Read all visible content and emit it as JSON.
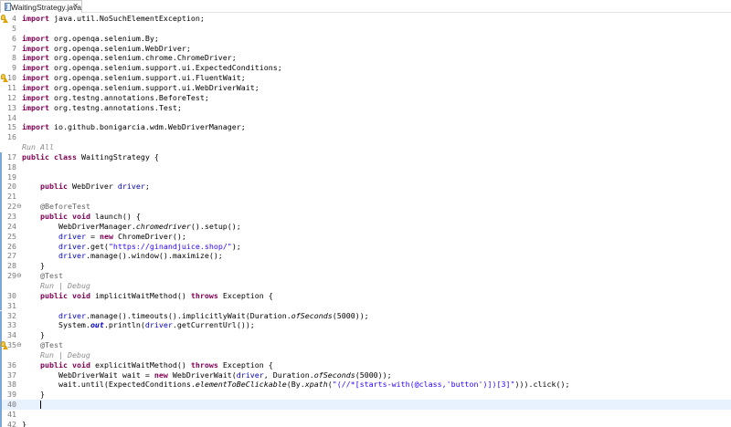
{
  "tab": {
    "title": "WaitingStrategy.java",
    "close": "✕",
    "icon": "java-file-icon"
  },
  "lines": [
    {
      "num": "4",
      "marker": "warning-bulb",
      "ruler": "none",
      "fold": "",
      "current": false,
      "segments": [
        {
          "t": "import",
          "c": "kw"
        },
        {
          "t": " java.util.NoSuchElementException;",
          "c": ""
        }
      ]
    },
    {
      "num": "5",
      "ruler": "none",
      "segments": []
    },
    {
      "num": "6",
      "ruler": "none",
      "segments": [
        {
          "t": "import",
          "c": "kw"
        },
        {
          "t": " org.openqa.selenium.By;",
          "c": ""
        }
      ]
    },
    {
      "num": "7",
      "ruler": "none",
      "segments": [
        {
          "t": "import",
          "c": "kw"
        },
        {
          "t": " org.openqa.selenium.WebDriver;",
          "c": ""
        }
      ]
    },
    {
      "num": "8",
      "ruler": "none",
      "segments": [
        {
          "t": "import",
          "c": "kw"
        },
        {
          "t": " org.openqa.selenium.chrome.ChromeDriver;",
          "c": ""
        }
      ]
    },
    {
      "num": "9",
      "ruler": "none",
      "segments": [
        {
          "t": "import",
          "c": "kw"
        },
        {
          "t": " org.openqa.selenium.support.ui.ExpectedConditions;",
          "c": ""
        }
      ]
    },
    {
      "num": "10",
      "marker": "warning-bulb",
      "ruler": "none",
      "segments": [
        {
          "t": "import",
          "c": "kw"
        },
        {
          "t": " org.openqa.selenium.support.ui.FluentWait;",
          "c": ""
        }
      ]
    },
    {
      "num": "11",
      "ruler": "none",
      "segments": [
        {
          "t": "import",
          "c": "kw"
        },
        {
          "t": " org.openqa.selenium.support.ui.WebDriverWait;",
          "c": ""
        }
      ]
    },
    {
      "num": "12",
      "ruler": "none",
      "segments": [
        {
          "t": "import",
          "c": "kw"
        },
        {
          "t": " org.testng.annotations.BeforeTest;",
          "c": ""
        }
      ]
    },
    {
      "num": "13",
      "ruler": "none",
      "segments": [
        {
          "t": "import",
          "c": "kw"
        },
        {
          "t": " org.testng.annotations.Test;",
          "c": ""
        }
      ]
    },
    {
      "num": "14",
      "ruler": "none",
      "segments": []
    },
    {
      "num": "15",
      "ruler": "none",
      "segments": [
        {
          "t": "import",
          "c": "kw"
        },
        {
          "t": " io.github.bonigarcia.wdm.WebDriverManager;",
          "c": ""
        }
      ]
    },
    {
      "num": "16",
      "ruler": "none",
      "segments": []
    },
    {
      "num": "",
      "ruler": "none",
      "segments": [
        {
          "t": "Run All",
          "c": "lens"
        }
      ]
    },
    {
      "num": "17",
      "ruler": "blue",
      "segments": [
        {
          "t": "public",
          "c": "kw"
        },
        {
          "t": " ",
          "c": ""
        },
        {
          "t": "class",
          "c": "kw"
        },
        {
          "t": " WaitingStrategy {",
          "c": ""
        }
      ]
    },
    {
      "num": "18",
      "ruler": "blue",
      "segments": []
    },
    {
      "num": "19",
      "ruler": "blue",
      "segments": []
    },
    {
      "num": "20",
      "ruler": "blue",
      "segments": [
        {
          "t": "    ",
          "c": ""
        },
        {
          "t": "public",
          "c": "kw"
        },
        {
          "t": " WebDriver ",
          "c": ""
        },
        {
          "t": "driver",
          "c": "fld"
        },
        {
          "t": ";",
          "c": ""
        }
      ]
    },
    {
      "num": "21",
      "ruler": "blue",
      "segments": []
    },
    {
      "num": "22",
      "ruler": "blue",
      "fold": "⊖",
      "segments": [
        {
          "t": "    ",
          "c": ""
        },
        {
          "t": "@BeforeTest",
          "c": "ann"
        }
      ]
    },
    {
      "num": "23",
      "ruler": "blue",
      "segments": [
        {
          "t": "    ",
          "c": ""
        },
        {
          "t": "public",
          "c": "kw"
        },
        {
          "t": " ",
          "c": ""
        },
        {
          "t": "void",
          "c": "kw"
        },
        {
          "t": " launch() {",
          "c": ""
        }
      ]
    },
    {
      "num": "24",
      "ruler": "blue",
      "segments": [
        {
          "t": "        WebDriverManager.",
          "c": ""
        },
        {
          "t": "chromedriver",
          "c": "it"
        },
        {
          "t": "().setup();",
          "c": ""
        }
      ]
    },
    {
      "num": "25",
      "ruler": "blue",
      "segments": [
        {
          "t": "        ",
          "c": ""
        },
        {
          "t": "driver",
          "c": "fld"
        },
        {
          "t": " = ",
          "c": ""
        },
        {
          "t": "new",
          "c": "kw"
        },
        {
          "t": " ChromeDriver();",
          "c": ""
        }
      ]
    },
    {
      "num": "26",
      "ruler": "blue",
      "segments": [
        {
          "t": "        ",
          "c": ""
        },
        {
          "t": "driver",
          "c": "fld"
        },
        {
          "t": ".get(",
          "c": ""
        },
        {
          "t": "\"https://ginandjuice.shop/\"",
          "c": "str"
        },
        {
          "t": ");",
          "c": ""
        }
      ]
    },
    {
      "num": "27",
      "ruler": "blue",
      "segments": [
        {
          "t": "        ",
          "c": ""
        },
        {
          "t": "driver",
          "c": "fld"
        },
        {
          "t": ".manage().window().maximize();",
          "c": ""
        }
      ]
    },
    {
      "num": "28",
      "ruler": "blue",
      "segments": [
        {
          "t": "    }",
          "c": ""
        }
      ]
    },
    {
      "num": "29",
      "ruler": "blue",
      "fold": "⊖",
      "segments": [
        {
          "t": "    ",
          "c": ""
        },
        {
          "t": "@Test",
          "c": "ann"
        }
      ]
    },
    {
      "num": "",
      "ruler": "blue",
      "segments": [
        {
          "t": "    ",
          "c": ""
        },
        {
          "t": "Run | Debug",
          "c": "lens"
        }
      ]
    },
    {
      "num": "30",
      "ruler": "blue",
      "segments": [
        {
          "t": "    ",
          "c": ""
        },
        {
          "t": "public",
          "c": "kw"
        },
        {
          "t": " ",
          "c": ""
        },
        {
          "t": "void",
          "c": "kw"
        },
        {
          "t": " implicitWaitMethod() ",
          "c": ""
        },
        {
          "t": "throws",
          "c": "kw"
        },
        {
          "t": " Exception {",
          "c": ""
        }
      ]
    },
    {
      "num": "31",
      "ruler": "blue",
      "segments": []
    },
    {
      "num": "32",
      "ruler": "blue",
      "segments": [
        {
          "t": "        ",
          "c": ""
        },
        {
          "t": "driver",
          "c": "fld"
        },
        {
          "t": ".manage().timeouts().implicitlyWait(Duration.",
          "c": ""
        },
        {
          "t": "ofSeconds",
          "c": "it"
        },
        {
          "t": "(5000));",
          "c": ""
        }
      ]
    },
    {
      "num": "33",
      "ruler": "blue",
      "segments": [
        {
          "t": "        System.",
          "c": ""
        },
        {
          "t": "out",
          "c": "stfld"
        },
        {
          "t": ".println(",
          "c": ""
        },
        {
          "t": "driver",
          "c": "fld"
        },
        {
          "t": ".getCurrentUrl());",
          "c": ""
        }
      ]
    },
    {
      "num": "34",
      "ruler": "blue",
      "segments": [
        {
          "t": "    }",
          "c": ""
        }
      ]
    },
    {
      "num": "35",
      "ruler": "blue",
      "marker": "warning-bulb",
      "fold": "⊖",
      "segments": [
        {
          "t": "    ",
          "c": ""
        },
        {
          "t": "@Test",
          "c": "ann"
        }
      ]
    },
    {
      "num": "",
      "ruler": "blue",
      "segments": [
        {
          "t": "    ",
          "c": ""
        },
        {
          "t": "Run | Debug",
          "c": "lens"
        }
      ]
    },
    {
      "num": "36",
      "ruler": "blue",
      "segments": [
        {
          "t": "    ",
          "c": ""
        },
        {
          "t": "public",
          "c": "kw"
        },
        {
          "t": " ",
          "c": ""
        },
        {
          "t": "void",
          "c": "kw"
        },
        {
          "t": " explicitWaitMethod() ",
          "c": ""
        },
        {
          "t": "throws",
          "c": "kw"
        },
        {
          "t": " Exception {",
          "c": ""
        }
      ]
    },
    {
      "num": "37",
      "ruler": "blue",
      "segments": [
        {
          "t": "        WebDriverWait wait = ",
          "c": ""
        },
        {
          "t": "new",
          "c": "kw"
        },
        {
          "t": " WebDriverWait(",
          "c": ""
        },
        {
          "t": "driver",
          "c": "fld"
        },
        {
          "t": ", Duration.",
          "c": ""
        },
        {
          "t": "ofSeconds",
          "c": "it"
        },
        {
          "t": "(5000));",
          "c": ""
        }
      ]
    },
    {
      "num": "38",
      "ruler": "blue",
      "segments": [
        {
          "t": "        wait.until(ExpectedConditions.",
          "c": ""
        },
        {
          "t": "elementToBeClickable",
          "c": "it"
        },
        {
          "t": "(By.",
          "c": ""
        },
        {
          "t": "xpath",
          "c": "it"
        },
        {
          "t": "(",
          "c": ""
        },
        {
          "t": "\"(//*[starts-with(@class,'button')])[3]\"",
          "c": "str"
        },
        {
          "t": "))).click();",
          "c": ""
        }
      ]
    },
    {
      "num": "39",
      "ruler": "blue",
      "segments": [
        {
          "t": "    }",
          "c": ""
        }
      ]
    },
    {
      "num": "40",
      "ruler": "blue",
      "current": true,
      "caret": true,
      "segments": [
        {
          "t": "    ",
          "c": ""
        }
      ]
    },
    {
      "num": "41",
      "ruler": "blue",
      "segments": []
    },
    {
      "num": "42",
      "ruler": "blue",
      "segments": [
        {
          "t": "}",
          "c": ""
        }
      ]
    }
  ]
}
